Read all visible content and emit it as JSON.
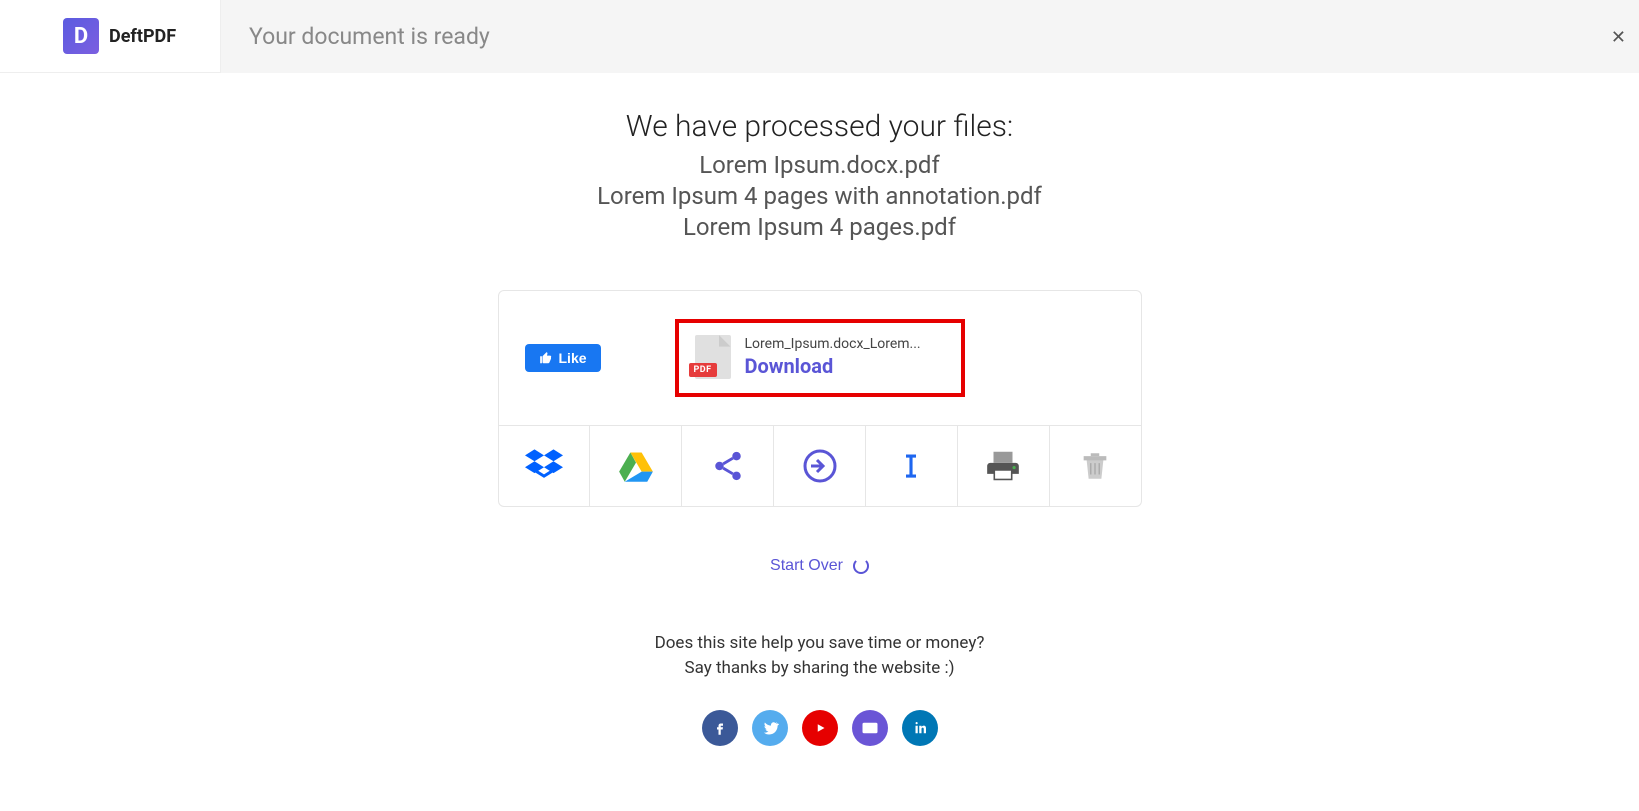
{
  "brand": {
    "initial": "D",
    "name": "DeftPDF"
  },
  "header": {
    "title": "Your document is ready"
  },
  "main": {
    "processed_heading": "We have processed your files:",
    "files": [
      "Lorem Ipsum.docx.pdf",
      "Lorem Ipsum 4 pages with annotation.pdf",
      "Lorem Ipsum 4 pages.pdf"
    ],
    "like_label": "Like",
    "download": {
      "filename": "Lorem_Ipsum.docx_Lorem...",
      "label": "Download",
      "badge": "PDF"
    },
    "start_over": "Start Over",
    "thanks_line1": "Does this site help you save time or money?",
    "thanks_line2": "Say thanks by sharing the website :)"
  },
  "actions": {
    "dropbox": "dropbox",
    "gdrive": "google-drive",
    "share": "share",
    "export": "export",
    "rename": "rename",
    "print": "print",
    "delete": "delete"
  },
  "social": {
    "facebook": "facebook",
    "twitter": "twitter",
    "youtube": "youtube",
    "email": "email",
    "linkedin": "linkedin"
  }
}
